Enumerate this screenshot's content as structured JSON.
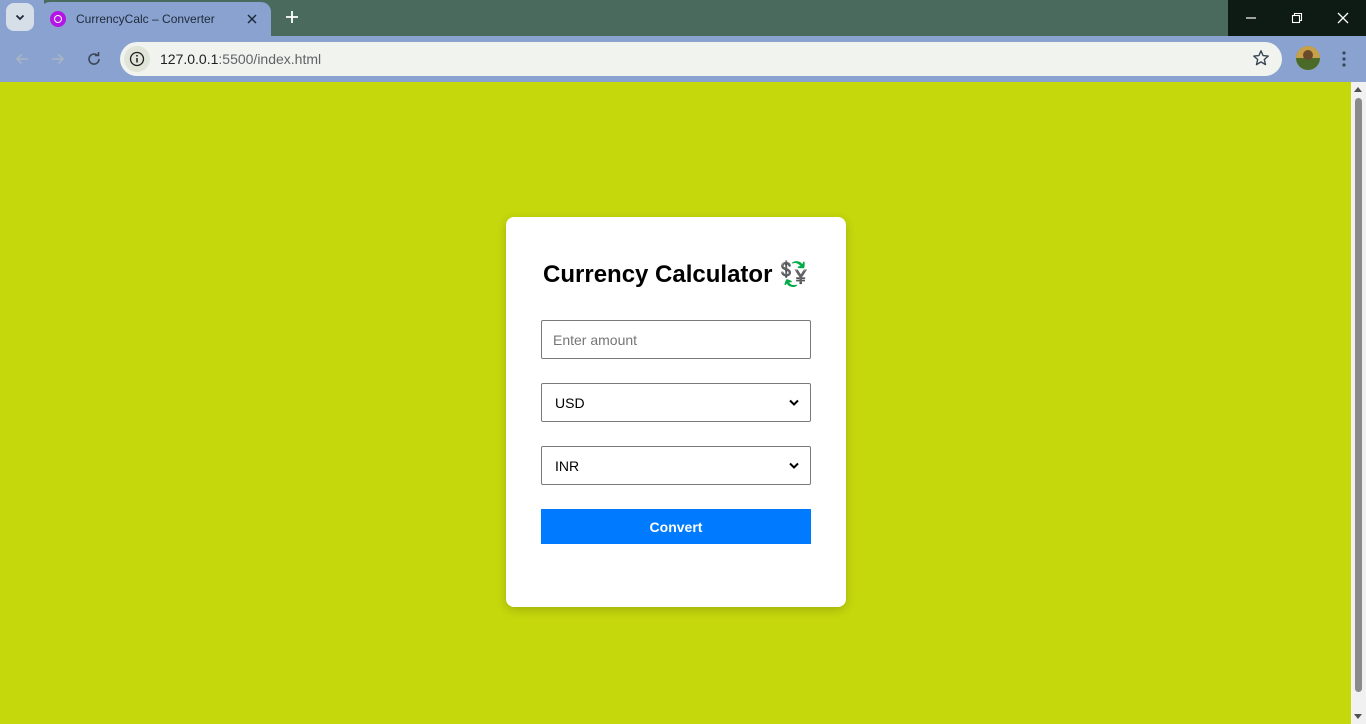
{
  "browser": {
    "tab_title": "CurrencyCalc – Converter",
    "url_host": "127.0.0.1",
    "url_rest": ":5500/index.html"
  },
  "page": {
    "background_color": "#c5d80c",
    "title": "Currency Calculator",
    "title_emoji": "💱",
    "amount_placeholder": "Enter amount",
    "from_currency": "USD",
    "to_currency": "INR",
    "convert_label": "Convert",
    "accent_color": "#007bff"
  }
}
